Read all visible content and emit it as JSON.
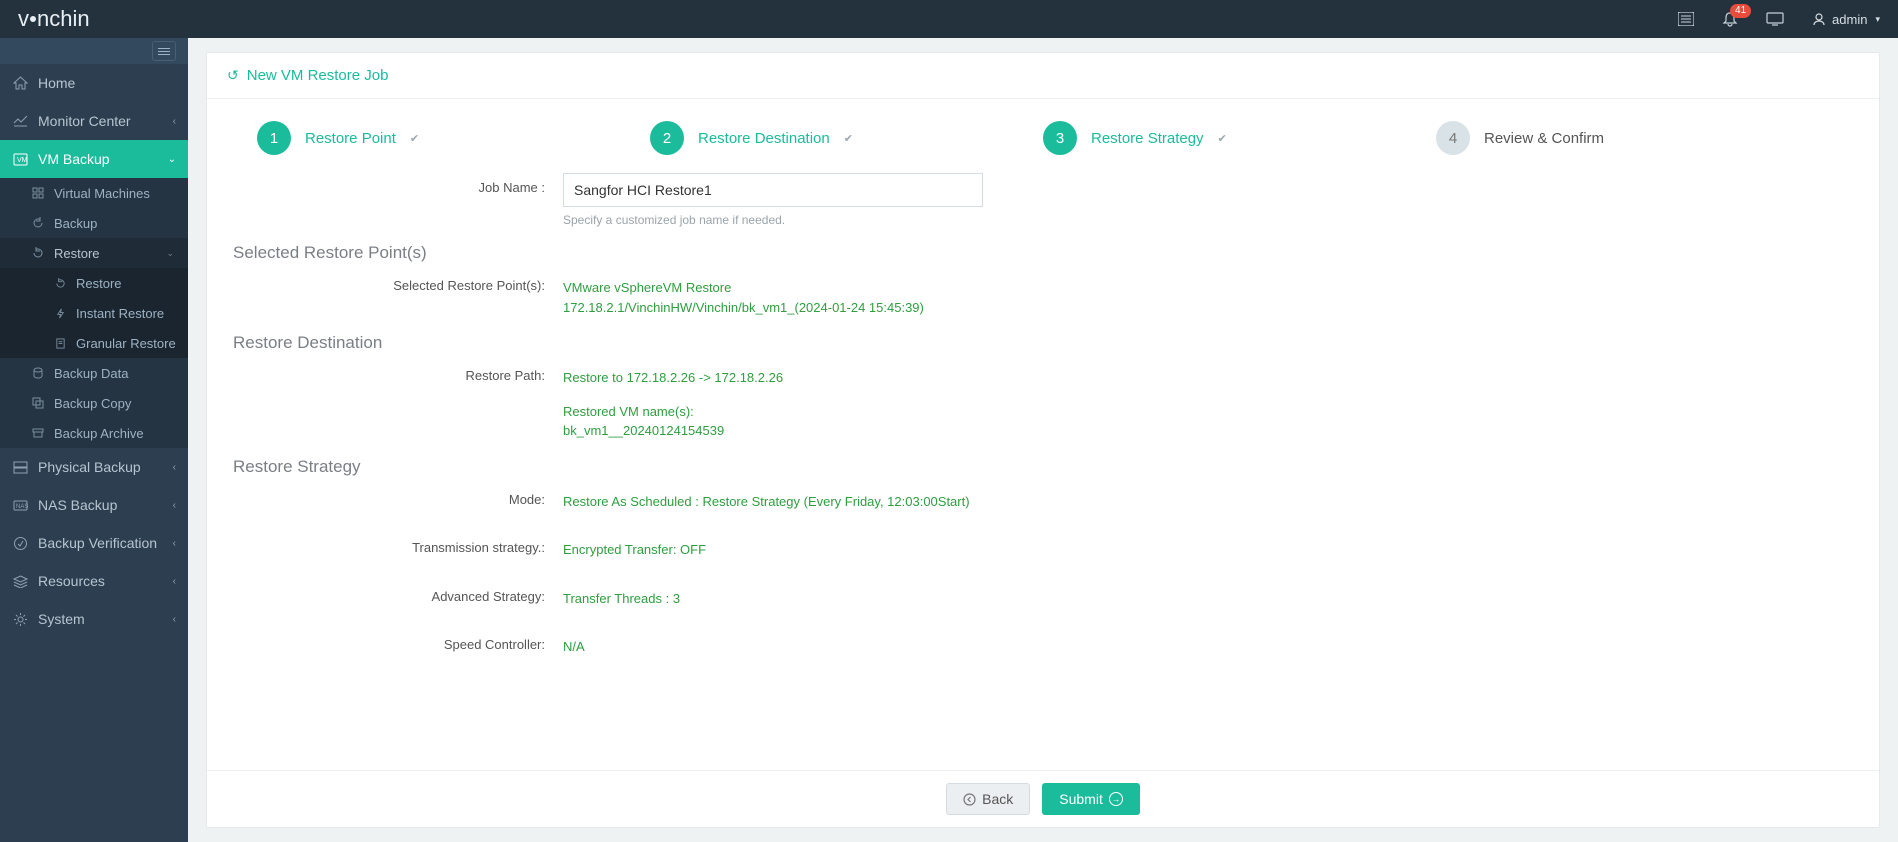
{
  "header": {
    "logo_text": "vinchin",
    "notification_count": "41",
    "user": "admin"
  },
  "sidebar": {
    "items": [
      {
        "label": "Home",
        "icon": "home"
      },
      {
        "label": "Monitor Center",
        "icon": "monitor",
        "caret": true
      },
      {
        "label": "VM Backup",
        "icon": "vm",
        "caret": true,
        "active": true,
        "children": [
          {
            "label": "Virtual Machines",
            "icon": "grid"
          },
          {
            "label": "Backup",
            "icon": "refresh"
          },
          {
            "label": "Restore",
            "icon": "refresh",
            "caret": true,
            "expanded": true,
            "children": [
              {
                "label": "Restore",
                "icon": "refresh"
              },
              {
                "label": "Instant Restore",
                "icon": "bolt"
              },
              {
                "label": "Granular Restore",
                "icon": "file"
              }
            ]
          },
          {
            "label": "Backup Data",
            "icon": "db"
          },
          {
            "label": "Backup Copy",
            "icon": "copy"
          },
          {
            "label": "Backup Archive",
            "icon": "archive"
          }
        ]
      },
      {
        "label": "Physical Backup",
        "icon": "server",
        "caret": true
      },
      {
        "label": "NAS Backup",
        "icon": "nas",
        "caret": true
      },
      {
        "label": "Backup Verification",
        "icon": "verify",
        "caret": true
      },
      {
        "label": "Resources",
        "icon": "res",
        "caret": true
      },
      {
        "label": "System",
        "icon": "gear",
        "caret": true
      }
    ]
  },
  "page": {
    "title": "New VM Restore Job",
    "wizard": [
      {
        "num": "1",
        "label": "Restore Point",
        "state": "done",
        "check": true
      },
      {
        "num": "2",
        "label": "Restore Destination",
        "state": "done",
        "check": true
      },
      {
        "num": "3",
        "label": "Restore Strategy",
        "state": "done",
        "check": true
      },
      {
        "num": "4",
        "label": "Review & Confirm",
        "state": "pending",
        "check": false
      }
    ],
    "job_name_label": "Job Name :",
    "job_name_value": "Sangfor HCI Restore1",
    "job_name_hint": "Specify a customized job name if needed.",
    "sections": {
      "restore_points": {
        "title": "Selected Restore Point(s)",
        "label": "Selected Restore Point(s):",
        "value_line1": "VMware vSphereVM Restore",
        "value_line2": "172.18.2.1/VinchinHW/Vinchin/bk_vm1_(2024-01-24 15:45:39)"
      },
      "destination": {
        "title": "Restore Destination",
        "label": "Restore Path:",
        "value_line1": "Restore to 172.18.2.26 -> 172.18.2.26",
        "value_line2": "Restored VM name(s):",
        "value_line3": "bk_vm1__20240124154539"
      },
      "strategy": {
        "title": "Restore Strategy",
        "mode_label": "Mode:",
        "mode_value": "Restore As Scheduled : Restore Strategy (Every Friday, 12:03:00Start)",
        "trans_label": "Transmission strategy.:",
        "trans_value": "Encrypted Transfer: OFF",
        "adv_label": "Advanced Strategy:",
        "adv_value": "Transfer Threads : 3",
        "speed_label": "Speed Controller:",
        "speed_value": "N/A"
      }
    },
    "buttons": {
      "back": "Back",
      "submit": "Submit"
    }
  }
}
